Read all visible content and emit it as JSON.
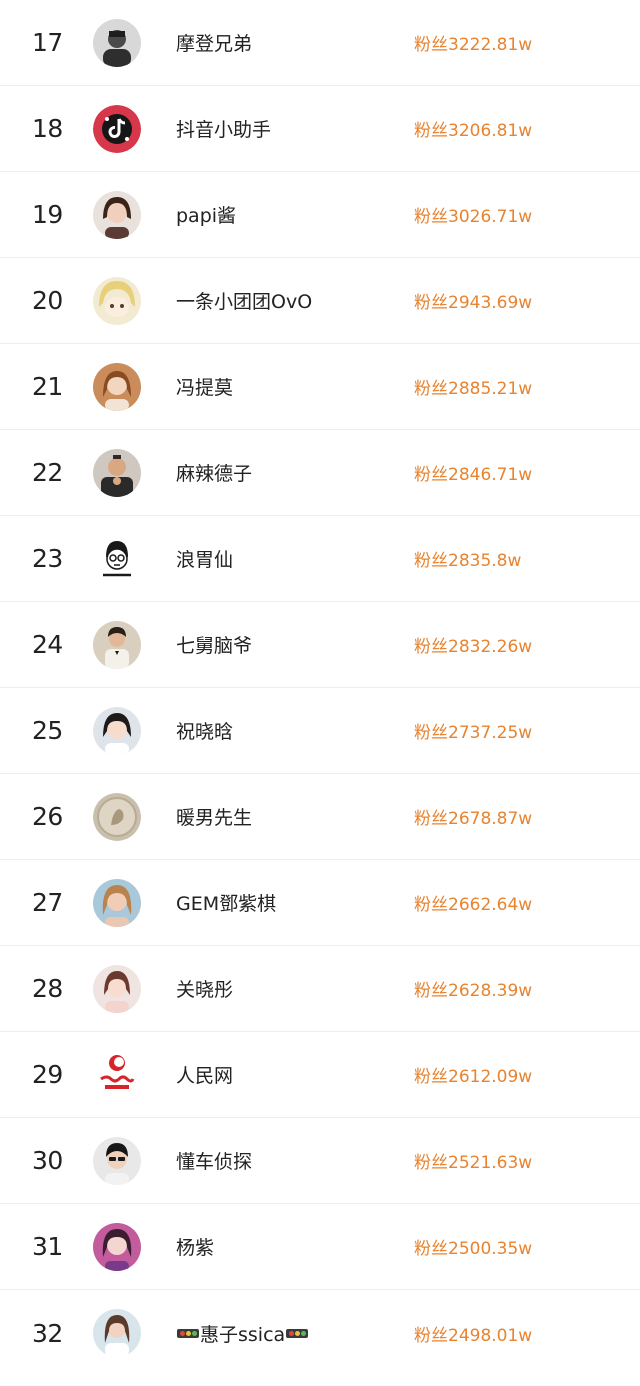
{
  "colors": {
    "accent": "#e8832f",
    "text": "#222222",
    "divider": "#eeeeee"
  },
  "rows": [
    {
      "rank": "17",
      "name": "摩登兄弟",
      "fans": "粉丝3222.81w",
      "avatar": "portrait-avatar"
    },
    {
      "rank": "18",
      "name": "抖音小助手",
      "fans": "粉丝3206.81w",
      "avatar": "douyin-logo-avatar"
    },
    {
      "rank": "19",
      "name": "papi酱",
      "fans": "粉丝3026.71w",
      "avatar": "portrait-avatar"
    },
    {
      "rank": "20",
      "name": "一条小团团OvO",
      "fans": "粉丝2943.69w",
      "avatar": "anime-avatar"
    },
    {
      "rank": "21",
      "name": "冯提莫",
      "fans": "粉丝2885.21w",
      "avatar": "portrait-avatar"
    },
    {
      "rank": "22",
      "name": "麻辣德子",
      "fans": "粉丝2846.71w",
      "avatar": "portrait-avatar"
    },
    {
      "rank": "23",
      "name": "浪胃仙",
      "fans": "粉丝2835.8w",
      "avatar": "cartoon-avatar"
    },
    {
      "rank": "24",
      "name": "七舅脑爷",
      "fans": "粉丝2832.26w",
      "avatar": "portrait-avatar"
    },
    {
      "rank": "25",
      "name": "祝晓晗",
      "fans": "粉丝2737.25w",
      "avatar": "portrait-avatar"
    },
    {
      "rank": "26",
      "name": "暖男先生",
      "fans": "粉丝2678.87w",
      "avatar": "coin-avatar"
    },
    {
      "rank": "27",
      "name": "GEM鄧紫棋",
      "fans": "粉丝2662.64w",
      "avatar": "portrait-avatar"
    },
    {
      "rank": "28",
      "name": "关晓彤",
      "fans": "粉丝2628.39w",
      "avatar": "portrait-avatar"
    },
    {
      "rank": "29",
      "name": "人民网",
      "fans": "粉丝2612.09w",
      "avatar": "people-cn-logo-avatar"
    },
    {
      "rank": "30",
      "name": "懂车侦探",
      "fans": "粉丝2521.63w",
      "avatar": "portrait-avatar"
    },
    {
      "rank": "31",
      "name": "杨紫",
      "fans": "粉丝2500.35w",
      "avatar": "portrait-avatar"
    },
    {
      "rank": "32",
      "name": "惠子ssica",
      "fans": "粉丝2498.01w",
      "avatar": "portrait-avatar"
    }
  ]
}
